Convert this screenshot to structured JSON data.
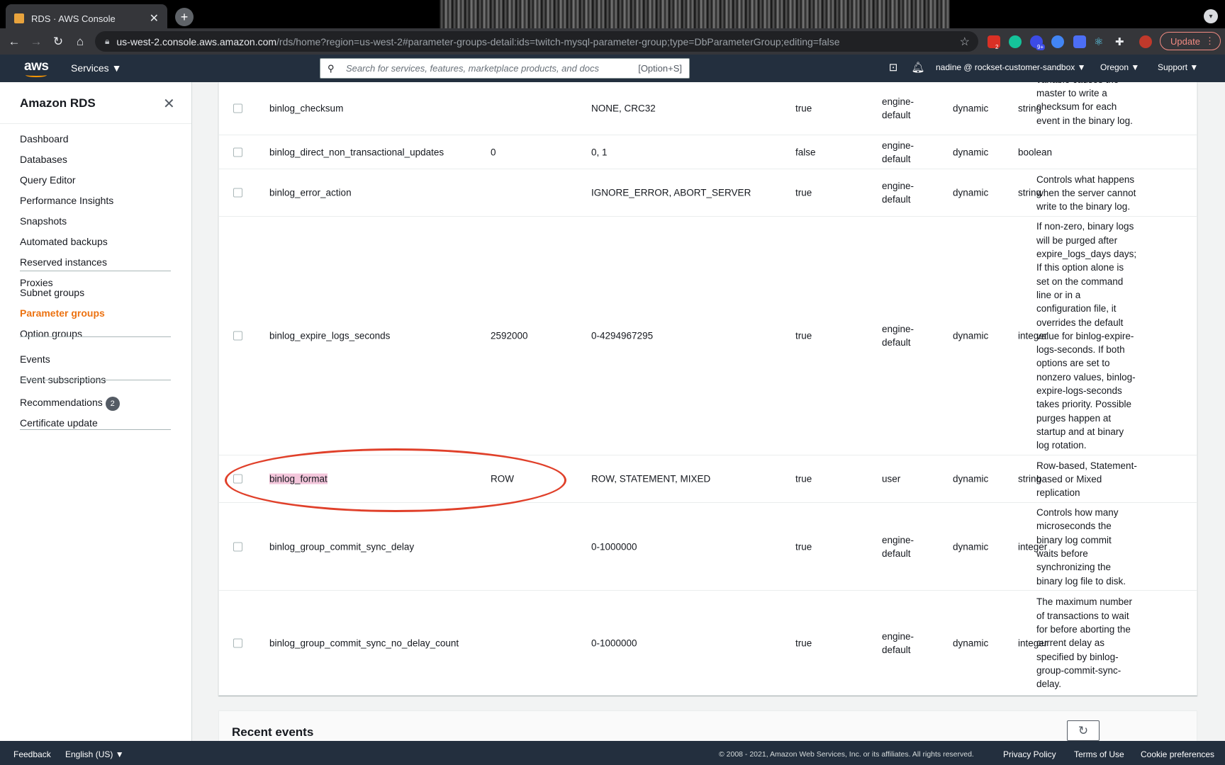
{
  "browser": {
    "tab_title": "RDS · AWS Console",
    "tab_close": "✕",
    "new_tab": "+",
    "url_host": "us-west-2.console.aws.amazon.com",
    "url_path": "/rds/home?region=us-west-2#parameter-groups-detail:ids=twitch-mysql-parameter-group;type=DbParameterGroup;editing=false",
    "update_label": "Update",
    "extension_badges": [
      "2",
      "9+"
    ]
  },
  "aws_header": {
    "logo": "aws",
    "services_label": "Services ▼",
    "search_placeholder": "Search for services, features, marketplace products, and docs",
    "search_shortcut": "[Option+S]",
    "account_label": "nadine @ rockset-customer-sandbox ▼",
    "region_label": "Oregon ▼",
    "support_label": "Support ▼"
  },
  "sidebar": {
    "title": "Amazon RDS",
    "groups": [
      [
        "Dashboard",
        "Databases",
        "Query Editor",
        "Performance Insights",
        "Snapshots",
        "Automated backups",
        "Reserved instances",
        "Proxies"
      ],
      [
        "Subnet groups",
        "Parameter groups",
        "Option groups"
      ],
      [
        "Events",
        "Event subscriptions"
      ],
      [
        "Recommendations",
        "Certificate update"
      ]
    ],
    "active_item": "Parameter groups",
    "recommendations_badge": "2"
  },
  "parameters": {
    "rows": [
      {
        "name": "binlog_checksum",
        "value": "",
        "allowed": "NONE, CRC32",
        "modifiable": "true",
        "source": [
          "engine-",
          "default"
        ],
        "apply": "dynamic",
        "type": "string",
        "description": [
          "variable causes the",
          "master to write a",
          "checksum for each",
          "event in the binary log."
        ]
      },
      {
        "name": "binlog_direct_non_transactional_updates",
        "value": "0",
        "allowed": "0, 1",
        "modifiable": "false",
        "source": [
          "engine-",
          "default"
        ],
        "apply": "dynamic",
        "type": "boolean",
        "description": []
      },
      {
        "name": "binlog_error_action",
        "value": "",
        "allowed": "IGNORE_ERROR, ABORT_SERVER",
        "modifiable": "true",
        "source": [
          "engine-",
          "default"
        ],
        "apply": "dynamic",
        "type": "string",
        "description": [
          "Controls what happens",
          "when the server cannot",
          "write to the binary log."
        ]
      },
      {
        "name": "binlog_expire_logs_seconds",
        "value": "2592000",
        "allowed": "0-4294967295",
        "modifiable": "true",
        "source": [
          "engine-",
          "default"
        ],
        "apply": "dynamic",
        "type": "integer",
        "description": [
          "If non-zero, binary logs",
          "will be purged after",
          "expire_logs_days days;",
          "If this option alone is",
          "set on the command",
          "line or in a",
          "configuration file, it",
          "overrides the default",
          "value for binlog-expire-",
          "logs-seconds. If both",
          "options are set to",
          "nonzero values, binlog-",
          "expire-logs-seconds",
          "takes priority. Possible",
          "purges happen at",
          "startup and at binary",
          "log rotation."
        ]
      },
      {
        "name": "binlog_format",
        "value": "ROW",
        "allowed": "ROW, STATEMENT, MIXED",
        "modifiable": "true",
        "source": [
          "user"
        ],
        "apply": "dynamic",
        "type": "string",
        "description": [
          "Row-based, Statement-",
          "based or Mixed",
          "replication"
        ]
      },
      {
        "name": "binlog_group_commit_sync_delay",
        "value": "",
        "allowed": "0-1000000",
        "modifiable": "true",
        "source": [
          "engine-",
          "default"
        ],
        "apply": "dynamic",
        "type": "integer",
        "description": [
          "Controls how many",
          "microseconds the",
          "binary log commit",
          "waits before",
          "synchronizing the",
          "binary log file to disk."
        ]
      },
      {
        "name": "binlog_group_commit_sync_no_delay_count",
        "value": "",
        "allowed": "0-1000000",
        "modifiable": "true",
        "source": [
          "engine-",
          "default"
        ],
        "apply": "dynamic",
        "type": "integer",
        "description": [
          "The maximum number",
          "of transactions to wait",
          "for before aborting the",
          "current delay as",
          "specified by binlog-",
          "group-commit-sync-",
          "delay."
        ]
      }
    ]
  },
  "recent_events": {
    "title": "Recent events"
  },
  "footer": {
    "feedback": "Feedback",
    "language": "English (US) ▼",
    "copyright": "© 2008 - 2021, Amazon Web Services, Inc. or its affiliates. All rights reserved.",
    "privacy": "Privacy Policy",
    "terms": "Terms of Use",
    "cookies": "Cookie preferences"
  },
  "colors": {
    "aws_nav": "#232f3e",
    "active_orange": "#ec7211",
    "highlight": "#f3c6db",
    "annotation_red": "#e0402a"
  }
}
